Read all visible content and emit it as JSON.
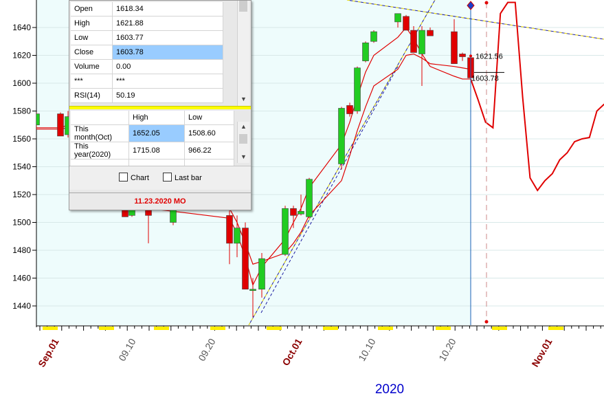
{
  "chart_data": {
    "type": "candlestick",
    "y_ticks": [
      1440,
      1460,
      1480,
      1500,
      1520,
      1540,
      1560,
      1580,
      1600,
      1620,
      1640
    ],
    "x_ticks": [
      {
        "label": "Sep.01",
        "month_start": true
      },
      {
        "label": "09.10",
        "month_start": false
      },
      {
        "label": "09.20",
        "month_start": false
      },
      {
        "label": "Oct.01",
        "month_start": true
      },
      {
        "label": "10.10",
        "month_start": false
      },
      {
        "label": "10.20",
        "month_start": false
      },
      {
        "label": "Nov.01",
        "month_start": true
      }
    ],
    "year_label": "2020",
    "candles": [
      {
        "open": 1570,
        "high": 1579,
        "low": 1567,
        "close": 1578
      },
      {
        "open": 1578,
        "high": 1579,
        "low": 1562,
        "close": 1562
      },
      {
        "open": 1563,
        "high": 1580,
        "low": 1561,
        "close": 1576
      },
      {
        "open": 1510,
        "high": 1520,
        "low": 1504,
        "close": 1504
      },
      {
        "open": 1505,
        "high": 1520,
        "low": 1504,
        "close": 1512
      },
      {
        "open": 1510,
        "high": 1512,
        "low": 1485,
        "close": 1505
      },
      {
        "open": 1500,
        "high": 1515,
        "low": 1498,
        "close": 1512
      },
      {
        "open": 1505,
        "high": 1515,
        "low": 1470,
        "close": 1485
      },
      {
        "open": 1485,
        "high": 1505,
        "low": 1475,
        "close": 1496
      },
      {
        "open": 1496,
        "high": 1500,
        "low": 1465,
        "close": 1452
      },
      {
        "open": 1452,
        "high": 1460,
        "low": 1432,
        "close": 1452
      },
      {
        "open": 1452,
        "high": 1478,
        "low": 1446,
        "close": 1474
      },
      {
        "open": 1477,
        "high": 1512,
        "low": 1476,
        "close": 1510
      },
      {
        "open": 1510,
        "high": 1512,
        "low": 1496,
        "close": 1505
      },
      {
        "open": 1506,
        "high": 1520,
        "low": 1505,
        "close": 1508
      },
      {
        "open": 1504,
        "high": 1532,
        "low": 1503,
        "close": 1531
      },
      {
        "open": 1542,
        "high": 1583,
        "low": 1538,
        "close": 1582
      },
      {
        "open": 1584,
        "high": 1586,
        "low": 1576,
        "close": 1578
      },
      {
        "open": 1580,
        "high": 1612,
        "low": 1578,
        "close": 1611
      },
      {
        "open": 1616,
        "high": 1630,
        "low": 1615,
        "close": 1629
      },
      {
        "open": 1630,
        "high": 1638,
        "low": 1629,
        "close": 1637
      },
      {
        "open": 1644,
        "high": 1650,
        "low": 1640,
        "close": 1650
      },
      {
        "open": 1648,
        "high": 1649,
        "low": 1638,
        "close": 1638
      },
      {
        "open": 1638,
        "high": 1641,
        "low": 1622,
        "close": 1622
      },
      {
        "open": 1621,
        "high": 1641,
        "low": 1598,
        "close": 1638
      },
      {
        "open": 1638,
        "high": 1640,
        "low": 1634,
        "close": 1634
      },
      {
        "open": 1637,
        "high": 1646,
        "low": 1614,
        "close": 1614
      },
      {
        "open": 1621,
        "high": 1622,
        "low": 1616,
        "close": 1619
      },
      {
        "open": 1618.34,
        "high": 1621.88,
        "low": 1603.77,
        "close": 1603.78
      }
    ],
    "moving_averages": [
      {
        "color": "#e00000",
        "values": [
          1567,
          1567,
          1568,
          1512,
          1515,
          1510,
          1508,
          1503,
          1492,
          1475,
          1455,
          1468,
          1488,
          1500,
          1510,
          1525,
          1556,
          1572,
          1590,
          1608,
          1620,
          1633,
          1640,
          1632,
          1621,
          1612,
          1605,
          1603,
          1603
        ]
      },
      {
        "color": "#e00000",
        "values": [
          1568,
          1568,
          1570,
          1520,
          1520,
          1516,
          1514,
          1510,
          1500,
          1485,
          1470,
          1472,
          1478,
          1485,
          1493,
          1505,
          1530,
          1548,
          1566,
          1583,
          1598,
          1610,
          1620,
          1621,
          1618,
          1614,
          1612,
          1611,
          1610
        ]
      }
    ],
    "forecast": [
      1588,
      1572,
      1568,
      1650,
      1658,
      1658,
      1590,
      1532,
      1523,
      1530,
      1535,
      1545,
      1550,
      1558,
      1560,
      1561,
      1580,
      1585
    ],
    "price_tags": [
      "1621.56",
      "1603.78"
    ],
    "highlight_colors": {
      "candle_up": "#22cc22",
      "candle_down": "#e00000",
      "background": "#eefcfc",
      "month_label": "#8b0000",
      "year_label": "#0000cc"
    }
  },
  "panel": {
    "quote_rows": [
      {
        "label": "Open",
        "value": "1618.34",
        "selected": false
      },
      {
        "label": "High",
        "value": "1621.88",
        "selected": false
      },
      {
        "label": "Low",
        "value": "1603.77",
        "selected": false
      },
      {
        "label": "Close",
        "value": "1603.78",
        "selected": true
      },
      {
        "label": "Volume",
        "value": "0.00",
        "selected": false
      },
      {
        "label": "***",
        "value": "***",
        "selected": false
      },
      {
        "label": "RSI(14)",
        "value": "50.19",
        "selected": false
      }
    ],
    "range_headers": [
      "",
      "High",
      "Low"
    ],
    "range_rows": [
      {
        "label": "This month(Oct)",
        "high": "1652.05",
        "low": "1508.60"
      },
      {
        "label": "This year(2020)",
        "high": "1715.08",
        "low": "966.22"
      }
    ],
    "checkbox_chart": "Chart",
    "checkbox_lastbar": "Last bar",
    "date": "11.23.2020 MO"
  }
}
